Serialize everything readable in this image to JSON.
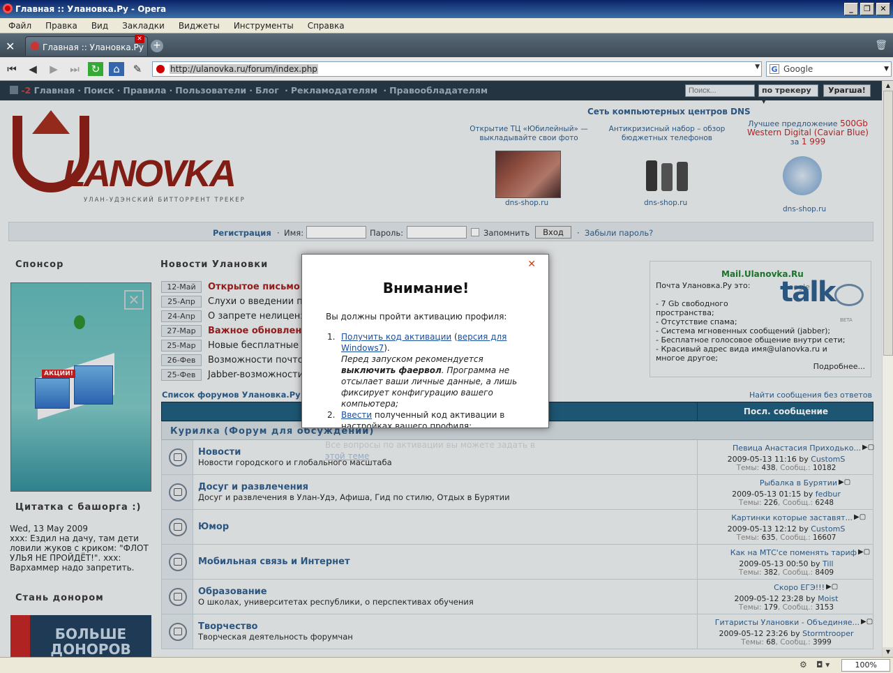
{
  "window": {
    "title": "Главная :: Улановка.Ру - Opera"
  },
  "menu": [
    "Файл",
    "Правка",
    "Вид",
    "Закладки",
    "Виджеты",
    "Инструменты",
    "Справка"
  ],
  "tab": {
    "label": "Главная :: Улановка.Ру"
  },
  "address": {
    "url": "http://ulanovka.ru/forum/index.php"
  },
  "search": {
    "placeholder": "Google"
  },
  "topnav": {
    "counter": "-2",
    "items": [
      "Главная",
      "Поиск",
      "Правила",
      "Пользователи",
      "Блог",
      "Рекламодателям",
      "Правообладателям"
    ],
    "search_placeholder": "Поиск...",
    "scope": "по трекеру",
    "go_label": "Урагша!"
  },
  "logo": {
    "word": "LANOVKA",
    "tagline": "УЛАН-УДЭНСКИЙ БИТТОРРЕНТ ТРЕКЕР"
  },
  "ads": {
    "title": "Сеть компьютерных центров DNS",
    "items": [
      {
        "caption": "Открытие ТЦ «Юбилейный» — выкладывайте свои фото",
        "link": "dns-shop.ru"
      },
      {
        "caption": "Антикризисный набор – обзор бюджетных телефонов",
        "link": "dns-shop.ru"
      },
      {
        "caption_pre": "Лучшее предложение",
        "caption_size": "500Gb",
        "caption_model": "Western Digital (Caviar Blue)",
        "caption_price_pre": "за",
        "caption_price": "1 999",
        "link": "dns-shop.ru"
      }
    ]
  },
  "login": {
    "register": "Регистрация",
    "name_label": "Имя:",
    "password_label": "Пароль:",
    "remember_label": "Запомнить",
    "login_button": "Вход",
    "forgot": "Забыли пароль?"
  },
  "sidebar": {
    "sponsor_title": "Спонсор",
    "sponsor_banner": "АКЦИИ!",
    "quote_title": "Цитатка с башорга :)",
    "quote_date": "Wed, 13 May 2009",
    "quote_text": "xxx: Ездил на дачу, там дети ловили жуков с криком: \"ФЛОТ УЛЬЯ НЕ ПРОЙДЁТ!\". xxx: Вархаммер надо запретить.",
    "donor_title": "Стань донором",
    "donor_banner": "БОЛЬШЕ ДОНОРОВ"
  },
  "news": {
    "title": "Новости Улановки",
    "items": [
      {
        "date": "12-Май",
        "text": "Открытое письмо д",
        "hot": true
      },
      {
        "date": "25-Апр",
        "text": "Слухи о введении пл",
        "hot": false
      },
      {
        "date": "24-Апр",
        "text": "О запрете нелиценз",
        "hot": false
      },
      {
        "date": "27-Мар",
        "text": "Важное обновление",
        "hot": true
      },
      {
        "date": "25-Мар",
        "text": "Новые бесплатные д",
        "hot": false
      },
      {
        "date": "26-Фев",
        "text": "Возможности почтов",
        "hot": false
      },
      {
        "date": "25-Фев",
        "text": "Jabber-возможности",
        "hot": false
      }
    ]
  },
  "mail": {
    "title": "Mail.Ulanovka.Ru",
    "intro": "Почта Улановка.Ру это:",
    "features": "- 7 Gb свободного\nпространства;\n- Отсутствие спама;\n- Система мгновенных сообщений (jabber);\n- Бесплатное голосовое общение внутри сети;\n- Красивый адрес вида имя@ulanovka.ru и\nмногое другое;",
    "more": "Подробнее...",
    "gtalk_word": "talk",
    "gtalk_brand": "Google",
    "gtalk_beta": "BETA"
  },
  "forums": {
    "title": "Список форумов Улановка.Ру",
    "find_link": "Найти сообщения без ответов",
    "last_col": "Посл. сообщение",
    "category": "Курилка (Форум для обсуждений)",
    "rows": [
      {
        "name": "Новости",
        "desc": "Новости городского и глобального масштаба",
        "last_title": "Певица Анастасия Приходько...",
        "last_date": "2009-05-13 11:16",
        "last_by": "by",
        "last_user": "CustomS",
        "topics_label": "Темы:",
        "topics": "438",
        "posts_label": "Сообщ.:",
        "posts": "10182"
      },
      {
        "name": "Досуг и развлечения",
        "desc": "Досуг и развлечения в Улан-Удэ, Афиша, Гид по стилю, Отдых в Бурятии",
        "last_title": "Рыбалка в Бурятии",
        "last_date": "2009-05-13 01:15",
        "last_by": "by",
        "last_user": "fedbur",
        "topics_label": "Темы:",
        "topics": "226",
        "posts_label": "Сообщ.:",
        "posts": "6248"
      },
      {
        "name": "Юмор",
        "desc": "",
        "last_title": "Картинки которые заставят...",
        "last_date": "2009-05-13 12:12",
        "last_by": "by",
        "last_user": "CustomS",
        "topics_label": "Темы:",
        "topics": "635",
        "posts_label": "Сообщ.:",
        "posts": "16607"
      },
      {
        "name": "Мобильная связь и Интернет",
        "desc": "",
        "last_title": "Как на МТС'се поменять тариф",
        "last_date": "2009-05-13 00:50",
        "last_by": "by",
        "last_user": "Till",
        "topics_label": "Темы:",
        "topics": "382",
        "posts_label": "Сообщ.:",
        "posts": "8409"
      },
      {
        "name": "Образование",
        "desc": "О школах, университетах республики, о перспективах обучения",
        "last_title": "Скоро ЕГЭ!!!",
        "last_date": "2009-05-12 23:28",
        "last_by": "by",
        "last_user": "Moist",
        "topics_label": "Темы:",
        "topics": "179",
        "posts_label": "Сообщ.:",
        "posts": "3153"
      },
      {
        "name": "Творчество",
        "desc": "Творческая деятельность форумчан",
        "last_title": "Гитаристы Улановки - Объединяе...",
        "last_date": "2009-05-12 23:26",
        "last_by": "by",
        "last_user": "Stormtrooper",
        "topics_label": "Темы:",
        "topics": "68",
        "posts_label": "Сообщ.:",
        "posts": "3999"
      }
    ]
  },
  "modal": {
    "title": "Внимание!",
    "lead": "Вы должны пройти активацию профиля:",
    "step1_link": "Получить код активации",
    "step1_paren_link": "версия для Windows7",
    "step1_note_a": "Перед запуском рекомендуется",
    "step1_note_bold": "выключить фаервол",
    "step1_note_b": ". Программа не отсылает ваши личные данные, а лишь фиксирует конфигурацию вашего компьютера;",
    "step2_link": "Ввести",
    "step2_text": "полученный код активации в настройках вашего профиля;",
    "faded_text": "Все вопросы по активации вы можете задать в",
    "faded_link": "этой теме"
  },
  "status": {
    "zoom": "100%"
  }
}
